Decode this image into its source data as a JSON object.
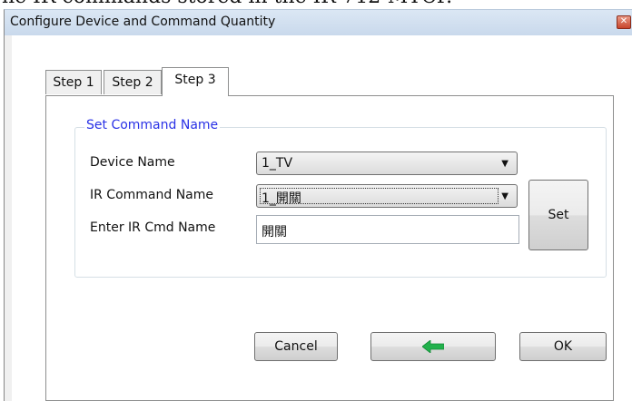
{
  "background_text": "ne IR commands stored in the IR-712-MTCP.",
  "window": {
    "title": "Configure Device and Command Quantity",
    "close_label": "✕"
  },
  "tabs": [
    {
      "label": "Step 1"
    },
    {
      "label": "Step 2"
    },
    {
      "label": "Step 3"
    }
  ],
  "active_tab": "Step 3",
  "group": {
    "title": "Set Command Name"
  },
  "form": {
    "device_name_label": "Device Name",
    "device_name_value": "1_TV",
    "ir_command_label": "IR Command Name",
    "ir_command_value": "1_開關",
    "enter_name_label": "Enter IR Cmd Name",
    "enter_name_value": "開關",
    "set_label": "Set"
  },
  "buttons": {
    "cancel_label": "Cancel",
    "ok_label": "OK",
    "back_icon": "green-left-arrow-icon"
  },
  "colors": {
    "group_title": "#2a32e6",
    "back_arrow": "#22b14c"
  }
}
